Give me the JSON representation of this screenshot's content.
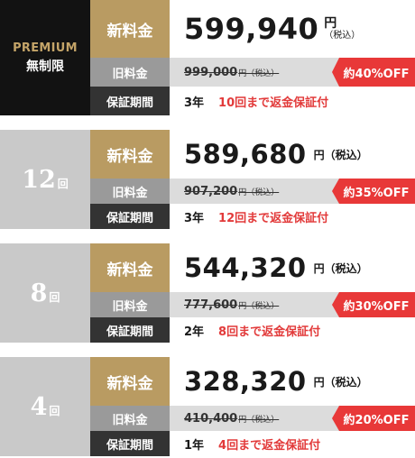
{
  "labels": {
    "new_fee": "新料金",
    "old_fee": "旧料金",
    "warranty": "保証期間"
  },
  "plans": [
    {
      "kind": "premium",
      "label_en": "PREMIUM",
      "label_ja": "無制限",
      "price": "599,940",
      "unit_main": "円",
      "unit_sub": "（税込）",
      "old_price": "999,000",
      "old_unit": "円（税込）",
      "discount": "約40%OFF",
      "years": "3年",
      "note": "10回まで返金保証付"
    },
    {
      "kind": "count",
      "count_num": "12",
      "count_unit": "回",
      "price": "589,680",
      "unit": "円（税込）",
      "old_price": "907,200",
      "old_unit": "円（税込）",
      "discount": "約35%OFF",
      "years": "3年",
      "note": "12回まで返金保証付"
    },
    {
      "kind": "count",
      "count_num": "8",
      "count_unit": "回",
      "price": "544,320",
      "unit": "円（税込）",
      "old_price": "777,600",
      "old_unit": "円（税込）",
      "discount": "約30%OFF",
      "years": "2年",
      "note": "8回まで返金保証付"
    },
    {
      "kind": "count",
      "count_num": "4",
      "count_unit": "回",
      "price": "328,320",
      "unit": "円（税込）",
      "old_price": "410,400",
      "old_unit": "円（税込）",
      "discount": "約20%OFF",
      "years": "1年",
      "note": "4回まで返金保証付"
    }
  ],
  "colors": {
    "gold": "#b99b62",
    "red": "#e83838",
    "dark": "#121212",
    "gray": "#c9c9c9"
  }
}
